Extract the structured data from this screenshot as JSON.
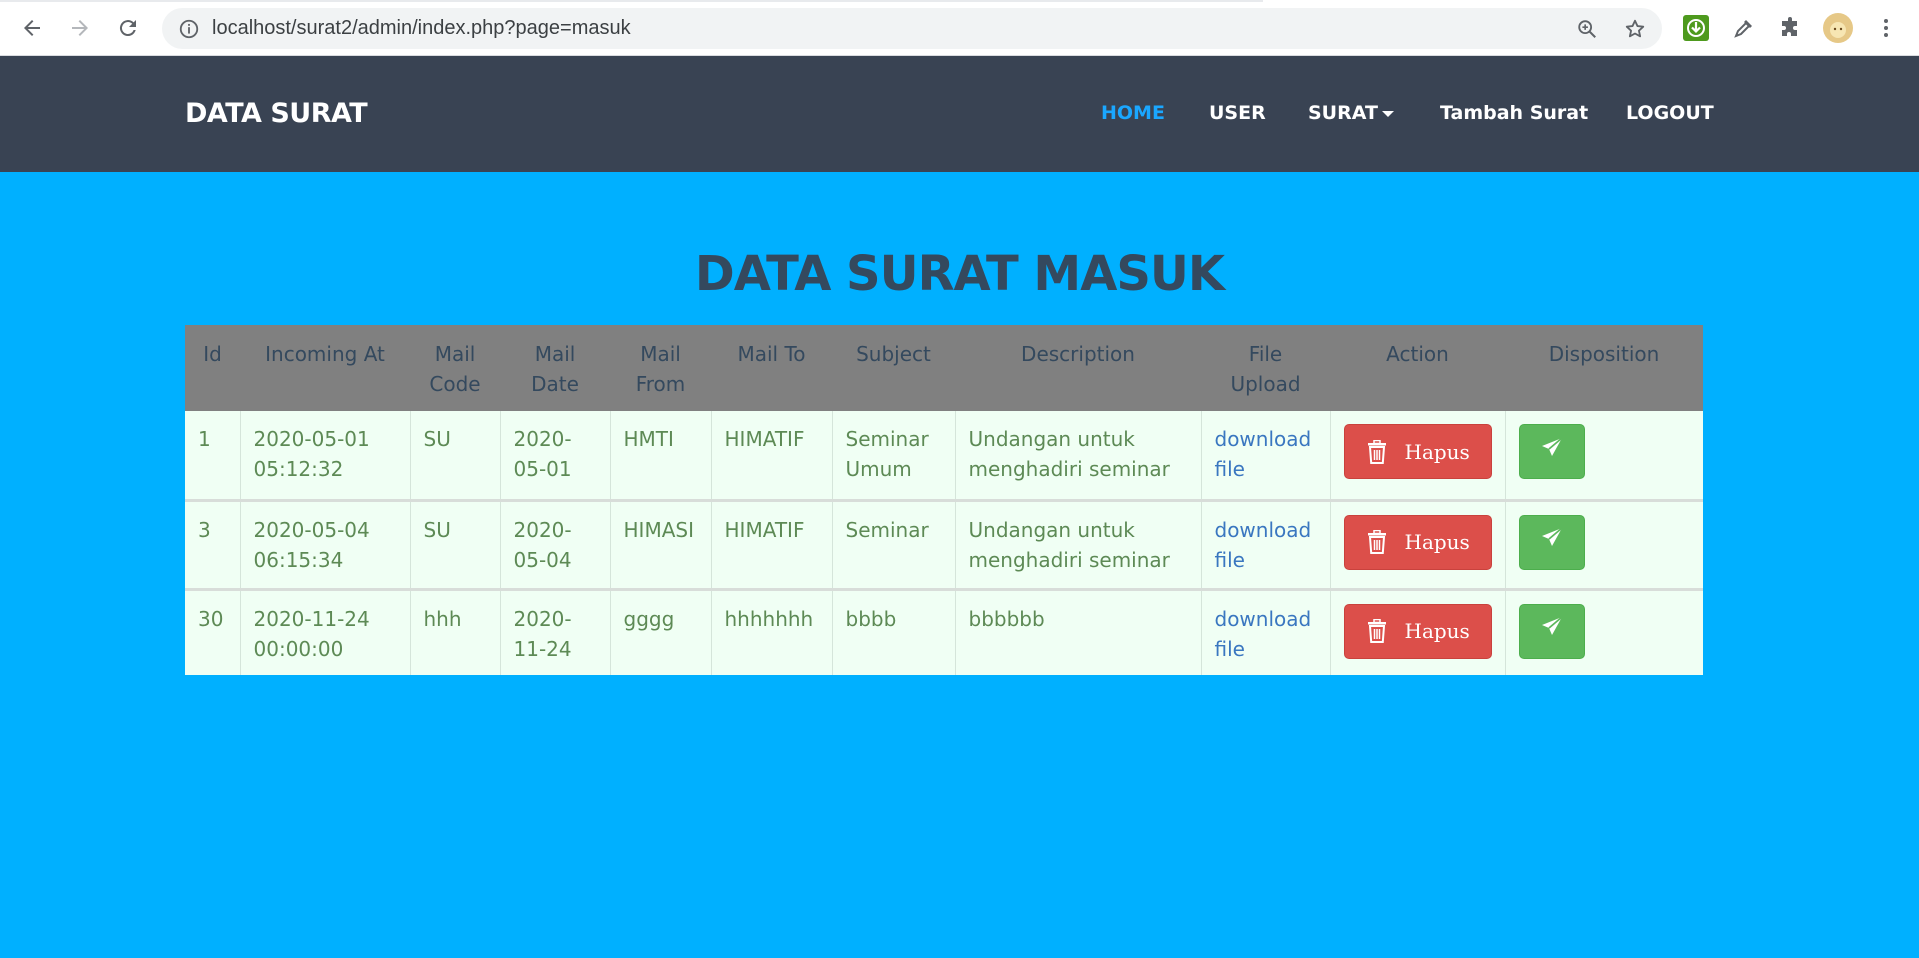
{
  "browser": {
    "url": "localhost/surat2/admin/index.php?page=masuk"
  },
  "navbar": {
    "brand": "DATA SURAT",
    "items": [
      {
        "label": "HOME",
        "active": true
      },
      {
        "label": "USER"
      },
      {
        "label": "SURAT"
      },
      {
        "label": "Tambah Surat"
      },
      {
        "label": "LOGOUT"
      }
    ]
  },
  "page": {
    "title": "DATA SURAT MASUK"
  },
  "table": {
    "headers": [
      [
        "Id"
      ],
      [
        "Incoming At"
      ],
      [
        "Mail",
        "Code"
      ],
      [
        "Mail",
        "Date"
      ],
      [
        "Mail",
        "From"
      ],
      [
        "Mail To"
      ],
      [
        "Subject"
      ],
      [
        "Description"
      ],
      [
        "File",
        "Upload"
      ],
      [
        "Action"
      ],
      [
        "Disposition"
      ]
    ],
    "rows": [
      {
        "id": "1",
        "incoming": [
          "2020-05-01",
          "05:12:32"
        ],
        "code": "SU",
        "date": [
          "2020-",
          "05-01"
        ],
        "from": "HMTI",
        "to": "HIMATIF",
        "subject": [
          "Seminar",
          "Umum"
        ],
        "description": [
          "Undangan untuk",
          "menghadiri seminar"
        ],
        "file": [
          "download",
          "file"
        ],
        "action": "Hapus"
      },
      {
        "id": "3",
        "incoming": [
          "2020-05-04",
          "06:15:34"
        ],
        "code": "SU",
        "date": [
          "2020-",
          "05-04"
        ],
        "from": "HIMASI",
        "to": "HIMATIF",
        "subject": [
          "Seminar",
          ""
        ],
        "description": [
          "Undangan untuk",
          "menghadiri seminar"
        ],
        "file": [
          "download",
          "file"
        ],
        "action": "Hapus"
      },
      {
        "id": "30",
        "incoming": [
          "2020-11-24",
          "00:00:00"
        ],
        "code": "hhh",
        "date": [
          "2020-",
          "11-24"
        ],
        "from": "gggg",
        "to": "hhhhhhh",
        "subject": [
          "bbbb",
          ""
        ],
        "description": [
          "bbbbbb",
          ""
        ],
        "file": [
          "download",
          "file"
        ],
        "action": "Hapus"
      }
    ]
  },
  "colors": {
    "page_bg": "#00b0ff",
    "navbar_bg": "#394353",
    "active_nav": "#1aa7ff",
    "header_bg": "#808080",
    "row_bg": "#f0fff4",
    "danger": "#dc4f4a",
    "success": "#5cb85c"
  },
  "icons": {
    "back": "arrow-left-icon",
    "forward": "arrow-right-icon",
    "reload": "reload-icon",
    "info": "info-icon",
    "zoom": "zoom-icon",
    "star": "star-icon",
    "trash": "trash-icon",
    "send": "paper-plane-icon"
  }
}
